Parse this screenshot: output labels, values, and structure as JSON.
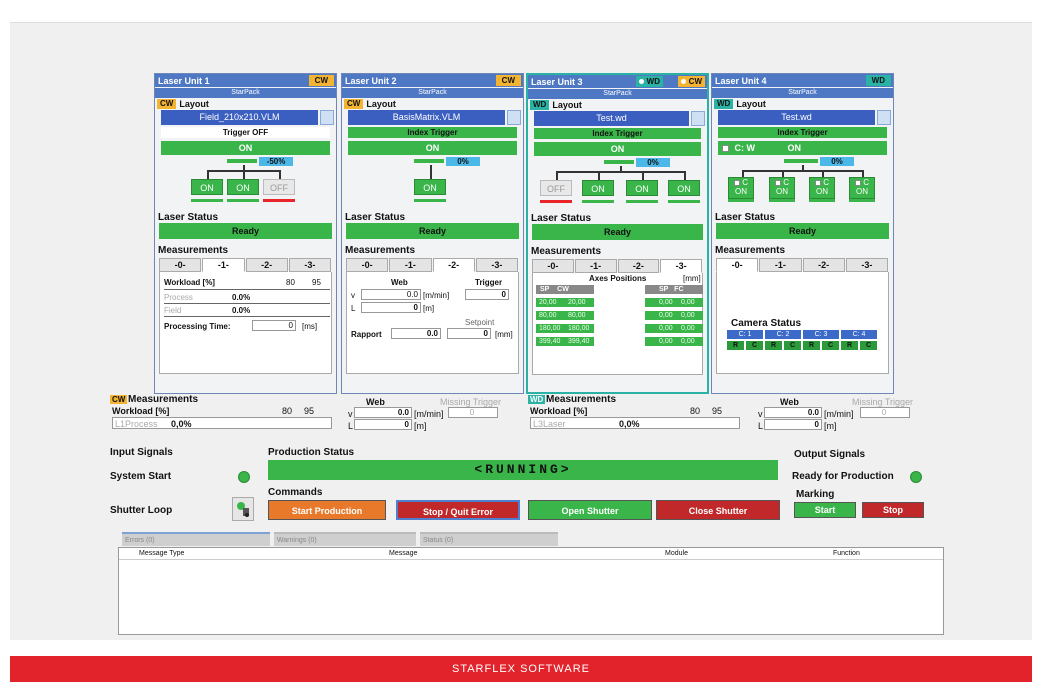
{
  "units": [
    {
      "title": "Laser Unit 1",
      "mode": "CW",
      "starpack": "StarPack",
      "layout_tag": "CW",
      "layout_label": "Layout",
      "file": "Field_210x210.VLM",
      "trigger": "Trigger OFF",
      "on_label": "ON",
      "pct": "-50%",
      "outputs": [
        "ON",
        "ON",
        "OFF"
      ],
      "status_label": "Laser Status",
      "status": "Ready",
      "meas_label": "Measurements",
      "tabs": [
        "-0-",
        "-1-",
        "-2-",
        "-3-"
      ],
      "active_tab": 1
    },
    {
      "title": "Laser Unit 2",
      "mode": "CW",
      "starpack": "StarPack",
      "layout_tag": "CW",
      "layout_label": "Layout",
      "file": "BasisMatrix.VLM",
      "trigger": "Index Trigger",
      "on_label": "ON",
      "pct": "0%",
      "outputs": [
        "ON"
      ],
      "status_label": "Laser Status",
      "status": "Ready",
      "meas_label": "Measurements",
      "tabs": [
        "-0-",
        "-1-",
        "-2-",
        "-3-"
      ],
      "active_tab": 2
    },
    {
      "title": "Laser Unit 3",
      "mode": "WD",
      "mode2": "CW",
      "starpack": "StarPack",
      "layout_tag": "WD",
      "layout_label": "Layout",
      "file": "Test.wd",
      "trigger": "Index Trigger",
      "on_label": "ON",
      "pct": "0%",
      "outputs": [
        "OFF",
        "ON",
        "ON",
        "ON"
      ],
      "status_label": "Laser Status",
      "status": "Ready",
      "meas_label": "Measurements",
      "tabs": [
        "-0-",
        "-1-",
        "-2-",
        "-3-"
      ],
      "active_tab": 3
    },
    {
      "title": "Laser Unit 4",
      "mode": "WD",
      "starpack": "StarPack",
      "layout_tag": "WD",
      "layout_label": "Layout",
      "file": "Test.wd",
      "trigger": "Index Trigger",
      "cw_label": "C: W",
      "on_label": "ON",
      "pct": "0%",
      "outputs": [
        "ON",
        "ON",
        "ON",
        "ON"
      ],
      "status_label": "Laser Status",
      "status": "Ready",
      "meas_label": "Measurements",
      "tabs": [
        "-0-",
        "-1-",
        "-2-",
        "-3-"
      ],
      "active_tab": 0
    }
  ],
  "u1_meas": {
    "workload": "Workload [%]",
    "v80": "80",
    "v95": "95",
    "process": "Process",
    "process_val": "0.0%",
    "field": "Field",
    "field_val": "0.0%",
    "proc_time": "Processing Time:",
    "proc_time_val": "0",
    "unit": "[ms]"
  },
  "u2_meas": {
    "web": "Web",
    "trigger": "Trigger",
    "v": "v",
    "v_val": "0.0",
    "v_unit": "[m/min]",
    "trig_val": "0",
    "l": "L",
    "l_val": "0",
    "l_unit": "[m]",
    "setpoint": "Setpoint",
    "rapport": "Rapport",
    "rapport_val": "0.0",
    "rapport_val2": "0",
    "rapport_unit": "[mm]"
  },
  "u3_meas": {
    "axes": "Axes Positions",
    "unit": "[mm]",
    "sp1": "SP",
    "cw": "CW",
    "sp2": "SP",
    "fc": "FC",
    "rows": [
      [
        "20,00",
        "20,00",
        "0,00",
        "0,00"
      ],
      [
        "80,00",
        "80,00",
        "0,00",
        "0,00"
      ],
      [
        "180,00",
        "180,00",
        "0,00",
        "0,00"
      ],
      [
        "399,40",
        "399,40",
        "0,00",
        "0,00"
      ]
    ]
  },
  "u4_meas": {
    "camera_status": "Camera Status",
    "cams": [
      "C: 1",
      "C: 2",
      "C: 3",
      "C: 4"
    ],
    "rc": [
      "R",
      "C",
      "R",
      "C",
      "R",
      "C",
      "R",
      "C"
    ]
  },
  "cw_meas": {
    "tag": "CW",
    "label": "Measurements",
    "workload": "Workload [%]",
    "v80": "80",
    "v95": "95",
    "field": "L1Process",
    "val": "0,0%",
    "web": "Web",
    "missing": "Missing Trigger",
    "missing_val": "0",
    "v": "v",
    "v_val": "0.0",
    "v_unit": "[m/min]",
    "l": "L",
    "l_val": "0",
    "l_unit": "[m]"
  },
  "wd_meas": {
    "tag": "WD",
    "label": "Measurements",
    "workload": "Workload [%]",
    "v80": "80",
    "v95": "95",
    "field": "L3Laser",
    "val": "0,0%",
    "web": "Web",
    "missing": "Missing Trigger",
    "missing_val": "0",
    "v": "v",
    "v_val": "0.0",
    "v_unit": "[m/min]",
    "l": "L",
    "l_val": "0",
    "l_unit": "[m]"
  },
  "input_signals": {
    "title": "Input Signals",
    "system_start": "System Start",
    "shutter_loop": "Shutter Loop"
  },
  "production": {
    "title": "Production Status",
    "status": "<RUNNING>"
  },
  "commands": {
    "title": "Commands",
    "start": "Start Production",
    "stop": "Stop / Quit Error",
    "open": "Open Shutter",
    "close": "Close Shutter"
  },
  "output_signals": {
    "title": "Output Signals",
    "ready": "Ready for Production",
    "marking": "Marking",
    "start": "Start",
    "stop": "Stop"
  },
  "msg_tabs": [
    "Errors (0)",
    "Warnings (0)",
    "Status (0)"
  ],
  "msg_headers": [
    "Message Type",
    "Message",
    "Module",
    "Function"
  ],
  "footer": "STARFLEX SOFTWARE",
  "colors": {
    "green": "#39b54a",
    "blue": "#4e78c4",
    "cw": "#f2b431",
    "wd": "#2ab3a5",
    "red": "#e8252b",
    "orange": "#e8782a"
  }
}
